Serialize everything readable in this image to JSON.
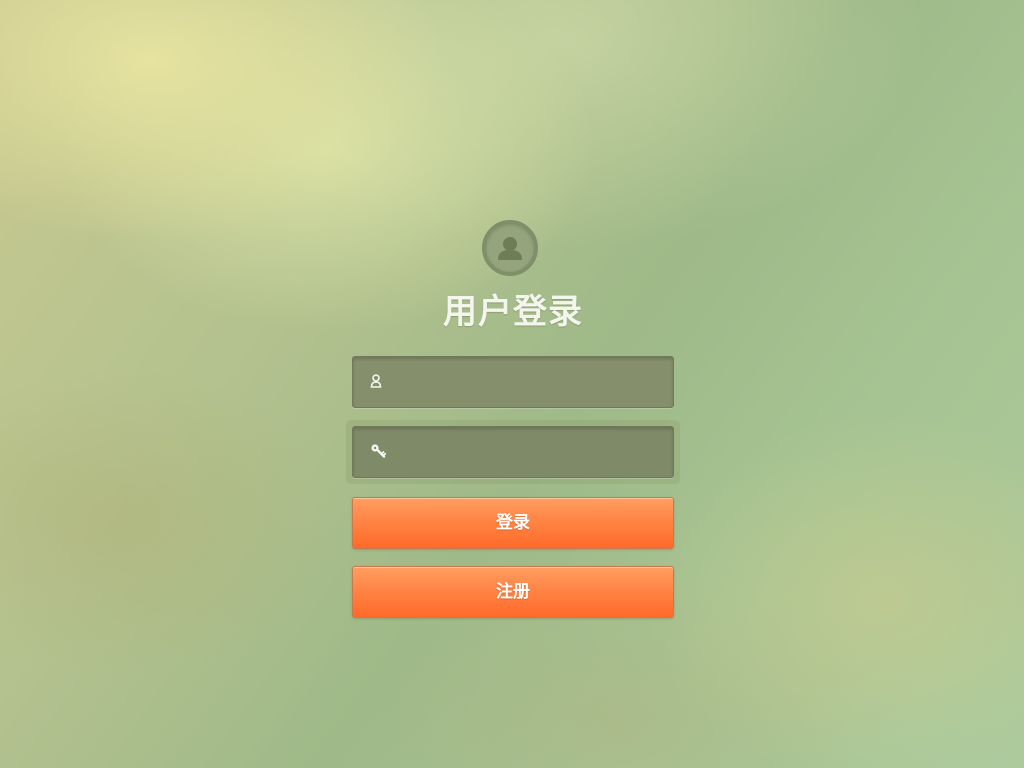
{
  "login": {
    "title": "用户登录",
    "avatar_icon": "user-avatar-icon",
    "username": {
      "icon": "user-icon",
      "value": "",
      "placeholder": ""
    },
    "password": {
      "icon": "key-icon",
      "value": "",
      "placeholder": ""
    },
    "login_button": "登录",
    "register_button": "注册"
  },
  "colors": {
    "button_orange": "#ff7a38",
    "field_bg": "#858f6b",
    "title_text": "#f4f6ee"
  }
}
